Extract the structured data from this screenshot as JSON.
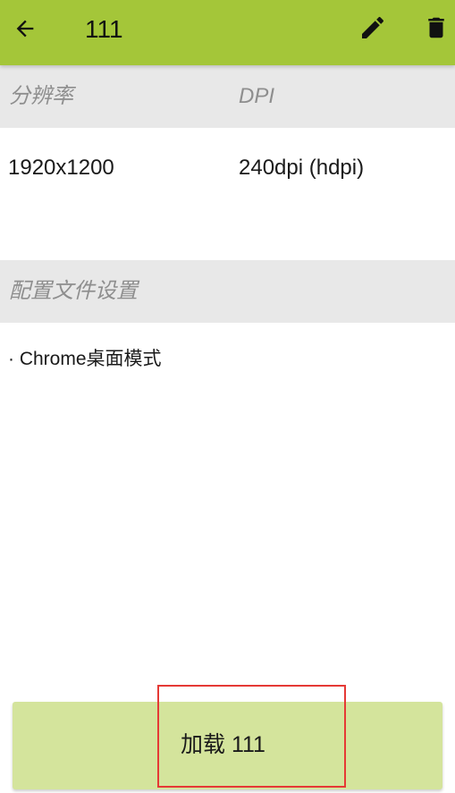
{
  "toolbar": {
    "title": "111",
    "back_icon": "arrow-left-icon",
    "edit_icon": "pencil-icon",
    "delete_icon": "trash-icon",
    "background_color": "#a4c639"
  },
  "display": {
    "headers": [
      "分辨率",
      "DPI"
    ],
    "resolution": "1920x1200",
    "dpi": "240dpi (hdpi)"
  },
  "profile_settings": {
    "header": "配置文件设置",
    "items": [
      "· Chrome桌面模式"
    ]
  },
  "load_button": {
    "label": "加载 111",
    "background_color": "#d4e49c",
    "highlight_color": "#e53935"
  }
}
